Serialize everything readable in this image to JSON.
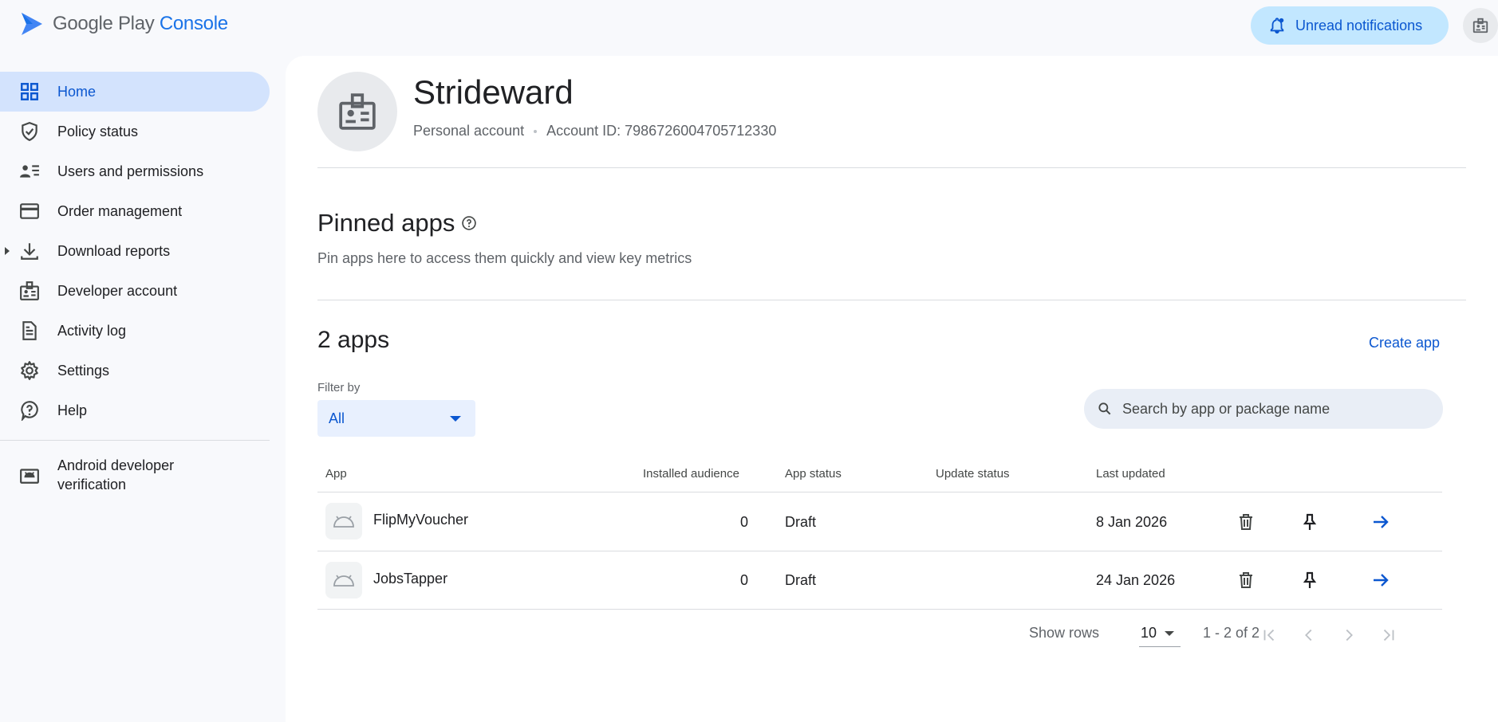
{
  "brand": {
    "word1": "Google Play",
    "word2": "Console"
  },
  "topbar": {
    "notifications_label": "Unread notifications"
  },
  "sidebar": {
    "items": [
      {
        "label": "Home",
        "icon": "dashboard-icon",
        "active": true
      },
      {
        "label": "Policy status",
        "icon": "shield-check-icon"
      },
      {
        "label": "Users and permissions",
        "icon": "users-list-icon"
      },
      {
        "label": "Order management",
        "icon": "credit-card-icon"
      },
      {
        "label": "Download reports",
        "icon": "download-icon"
      },
      {
        "label": "Developer account",
        "icon": "badge-icon"
      },
      {
        "label": "Activity log",
        "icon": "document-icon"
      },
      {
        "label": "Settings",
        "icon": "gear-icon"
      },
      {
        "label": "Help",
        "icon": "help-icon"
      }
    ],
    "verification": {
      "line1": "Android developer",
      "line2": "verification"
    }
  },
  "account": {
    "name": "Strideward",
    "type": "Personal account",
    "account_id": "Account ID: 7986726004705712330"
  },
  "pinned": {
    "title": "Pinned apps",
    "description": "Pin apps here to access them quickly and view key metrics"
  },
  "apps": {
    "count_label": "2 apps",
    "create_label": "Create app",
    "filter_label": "Filter by",
    "filter_value": "All",
    "search_placeholder": "Search by app or package name",
    "columns": [
      "App",
      "Installed audience",
      "App status",
      "Update status",
      "Last updated"
    ],
    "rows": [
      {
        "name": "FlipMyVoucher",
        "installed": "0",
        "status": "Draft",
        "update_status": "",
        "last_updated": "8 Jan 2026"
      },
      {
        "name": "JobsTapper",
        "installed": "0",
        "status": "Draft",
        "update_status": "",
        "last_updated": "24 Jan 2026"
      }
    ],
    "pagination": {
      "show_rows_label": "Show rows",
      "rows_value": "10",
      "range": "1 - 2 of 2"
    }
  },
  "colors": {
    "accent": "#0b57d0",
    "active_bg": "#d3e3fd",
    "notif_bg": "#c2e7ff"
  }
}
